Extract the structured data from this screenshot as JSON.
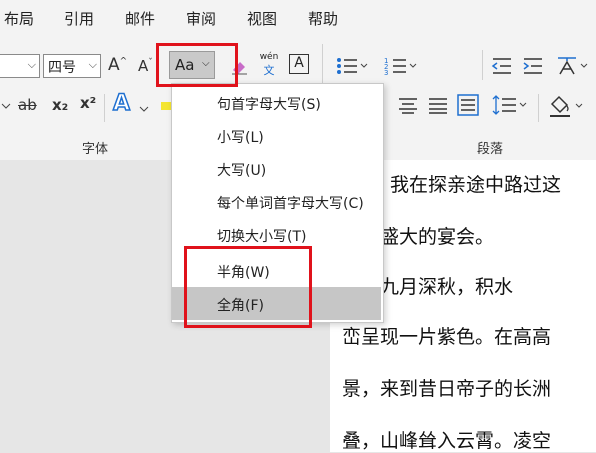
{
  "menu": [
    "布局",
    "引用",
    "邮件",
    "审阅",
    "视图",
    "帮助"
  ],
  "ribbon": {
    "font_name_value": "",
    "font_size_value": "四号",
    "grow_font_glyph": "A",
    "shrink_font_glyph": "A",
    "change_case_label": "Aa",
    "wen_top": "wén",
    "wen_bottom": "文",
    "char_border_glyph": "A",
    "strike_glyph": "ab",
    "subscript_glyph": "x₂",
    "superscript_glyph": "x²",
    "text_effect_glyph": "A",
    "font_group_label": "字体",
    "paragraph_group_label": "段落"
  },
  "change_case_menu": [
    {
      "label": "句首字母大写(S)",
      "selected": false
    },
    {
      "label": "小写(L)",
      "selected": false
    },
    {
      "label": "大写(U)",
      "selected": false
    },
    {
      "label": "每个单词首字母大写(C)",
      "selected": false
    },
    {
      "label": "切换大小写(T)",
      "selected": false
    },
    {
      "label": "半角(W)",
      "selected": false
    },
    {
      "label": "全角(F)",
      "selected": true
    }
  ],
  "document_lines": [
    "我在探亲途中路过这",
    "这次盛大的宴会。",
    "时值九月深秋，积水",
    "峦呈现一片紫色。在高高",
    "景，来到昔日帝子的长洲",
    "叠，山峰耸入云霄。凌空"
  ],
  "colors": {
    "highlight_red": "#e0121b",
    "accent_blue": "#1e6fd0",
    "selected_item": "#c6c6c6"
  }
}
